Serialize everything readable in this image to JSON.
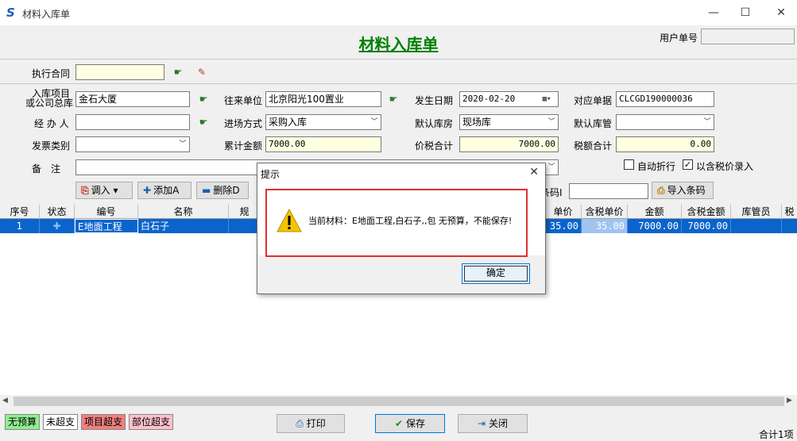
{
  "window": {
    "title": "材料入库单",
    "minimize": "—",
    "maximize": "☐",
    "close": "✕"
  },
  "header": {
    "form_title": "材料入库单",
    "user_label": "用户单号",
    "user_value": ""
  },
  "contract": {
    "label": "执行合同",
    "value": ""
  },
  "fields": {
    "project_label_1": "入库项目",
    "project_label_2": "或公司总库",
    "project_value": "金石大厦",
    "partner_label": "往来单位",
    "partner_value": "北京阳光100置业",
    "date_label": "发生日期",
    "date_value": "2020-02-20",
    "ref_label": "对应单据",
    "ref_value": "CLCGD190000036",
    "handler_label": "经 办 人",
    "handler_value": "",
    "entry_label": "进场方式",
    "entry_value": "采购入库",
    "warehouse_label": "默认库房",
    "warehouse_value": "现场库",
    "keeper_label": "默认库管",
    "keeper_value": "",
    "invoice_label": "发票类别",
    "invoice_value": "",
    "total_label": "累计金额",
    "total_value": "7000.00",
    "tax_total_label": "价税合计",
    "tax_total_value": "7000.00",
    "tax_label": "税额合计",
    "tax_value": "0.00",
    "note_label": "备　注",
    "note_value": "",
    "auto_discount_label": "自动折行",
    "auto_discount_checked": false,
    "tax_price_label": "以含税价录入",
    "tax_price_checked": true
  },
  "toolbar": {
    "import_label": "调入",
    "add_label": "添加A",
    "delete_label": "删除D",
    "barcode_label": "条码I",
    "barcode_value": "",
    "import_barcode_label": "导入条码"
  },
  "grid": {
    "headers": {
      "seq": "序号",
      "status": "状态",
      "code": "编号",
      "name": "名称",
      "spec": "规",
      "price": "单价",
      "tax_price": "含税单价",
      "amount": "金额",
      "tax_amount": "含税金额",
      "keeper": "库管员",
      "extra": "税"
    },
    "rows": [
      {
        "seq": "1",
        "status": "✚",
        "code": "E地面工程",
        "name": "白石子",
        "price": "35.00",
        "tax_price": "35.00",
        "amount": "7000.00",
        "tax_amount": "7000.00"
      }
    ]
  },
  "legend": {
    "no_budget": "无预算",
    "not_over": "未超支",
    "project_over": "项目超支",
    "dept_over": "部位超支"
  },
  "bottom": {
    "print_label": "打印",
    "save_label": "保存",
    "close_label": "关闭",
    "count_label": "合计1项"
  },
  "dialog": {
    "title": "提示",
    "message": "当前材料：E地面工程,白石子,,包 无预算，不能保存!",
    "ok_label": "确定",
    "close_glyph": "✕"
  },
  "colors": {
    "accent_green": "#008000",
    "selection": "#0a64cc",
    "alert_red": "#e03030",
    "warning_yellow": "#f5c400"
  }
}
